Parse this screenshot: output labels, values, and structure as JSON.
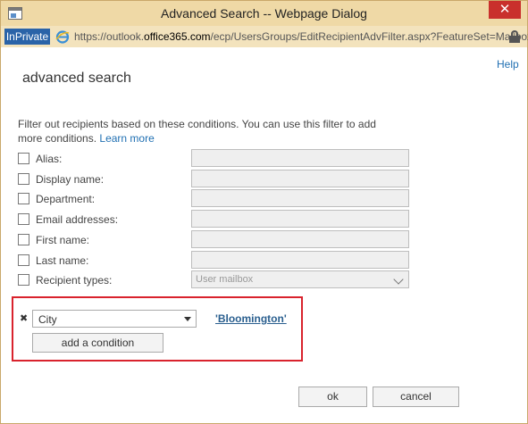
{
  "window": {
    "title": "Advanced Search -- Webpage Dialog",
    "close_glyph": "✕"
  },
  "addressbar": {
    "inprivate_label": "InPrivate",
    "url_prefix": "https://outlook.",
    "url_domain": "office365.com",
    "url_suffix": "/ecp/UsersGroups/EditRecipientAdvFilter.aspx?FeatureSet=Mailboxes"
  },
  "page": {
    "help_label": "Help",
    "title": "advanced search",
    "intro_text": "Filter out recipients based on these conditions. You can use this filter to add more conditions.",
    "learn_more_label": "Learn more"
  },
  "conditions": [
    {
      "label": "Alias:",
      "value": ""
    },
    {
      "label": "Display name:",
      "value": ""
    },
    {
      "label": "Department:",
      "value": ""
    },
    {
      "label": "Email addresses:",
      "value": ""
    },
    {
      "label": "First name:",
      "value": ""
    },
    {
      "label": "Last name:",
      "value": ""
    },
    {
      "label": "Recipient types:",
      "value": "User mailbox"
    }
  ],
  "custom_condition": {
    "remove_glyph": "✖",
    "field": "City",
    "value": "'Bloomington'",
    "add_label": "add a condition"
  },
  "footer": {
    "ok_label": "ok",
    "cancel_label": "cancel"
  },
  "colors": {
    "titlebar": "#efd9a6",
    "inprivate": "#2a63a8",
    "link": "#1f6fb2",
    "highlight": "#d9232d",
    "close": "#c9302c"
  }
}
